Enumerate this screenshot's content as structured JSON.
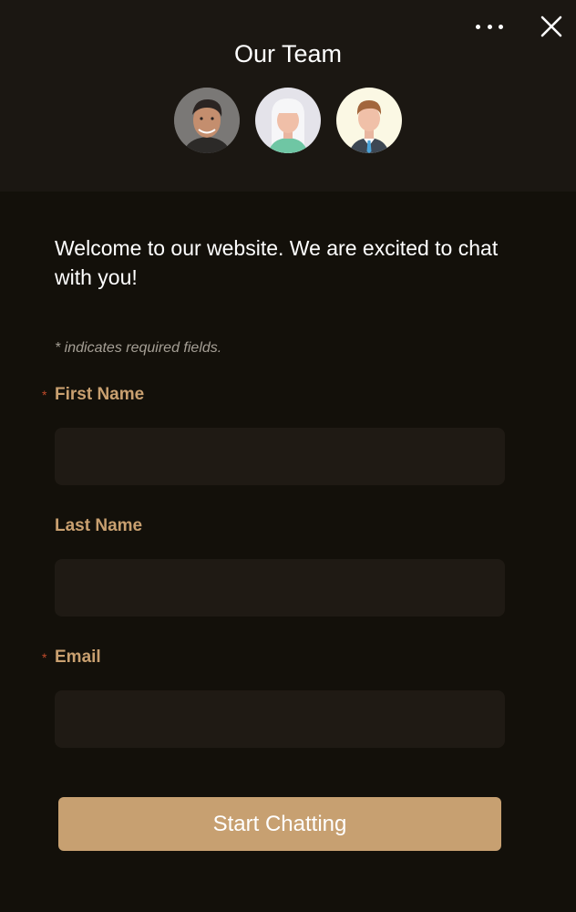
{
  "header": {
    "title": "Our Team",
    "more_icon": "more-horizontal-icon",
    "close_icon": "close-icon",
    "avatars": [
      "team-member-photo",
      "team-member-female",
      "team-member-male"
    ]
  },
  "welcome": {
    "message": "Welcome to our website. We are excited to chat with you!"
  },
  "form": {
    "required_note": "* indicates required fields.",
    "fields": [
      {
        "label": "First Name",
        "required": true,
        "value": ""
      },
      {
        "label": "Last Name",
        "required": false,
        "value": ""
      },
      {
        "label": "Email",
        "required": true,
        "value": ""
      }
    ],
    "submit_label": "Start Chatting"
  },
  "colors": {
    "background": "#13100a",
    "header_background": "#1b1712",
    "input_background": "#1f1a14",
    "accent": "#c7a071",
    "label": "#c9a070",
    "required_star": "#c04a2a"
  }
}
